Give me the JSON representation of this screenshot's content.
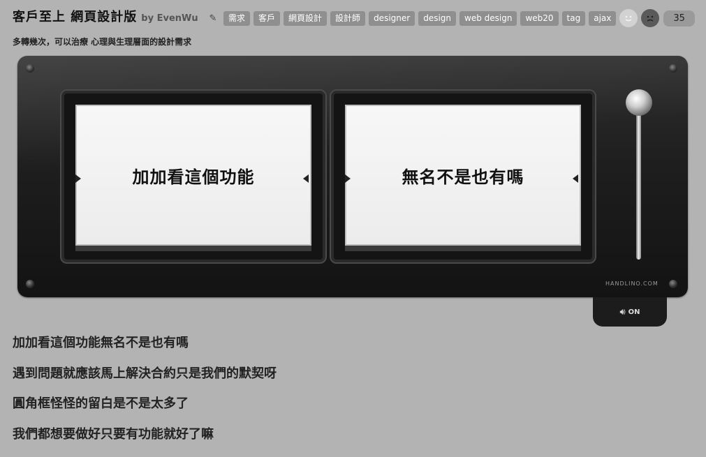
{
  "header": {
    "title": "客戶至上 網頁設計版",
    "byline": "by EvenWu",
    "edit_icon": "pencil-icon",
    "tags": [
      "需求",
      "客戶",
      "網頁設計",
      "設計師",
      "designer",
      "design",
      "web design",
      "web20",
      "tag",
      "ajax"
    ],
    "happy_icon": "smiley-face-icon",
    "sad_icon": "sad-face-icon",
    "vote_count": "35"
  },
  "subtitle": "多轉幾次，可以治療 心理與生理層面的設計需求",
  "slots": {
    "left_text": "加加看這個功能",
    "right_text": "無名不是也有嗎"
  },
  "device": {
    "brand": "HANDLINO.COM",
    "sound_icon": "speaker-icon",
    "sound_label": "ON"
  },
  "results": [
    "加加看這個功能無名不是也有嗎",
    "遇到問題就應該馬上解決合約只是我們的默契呀",
    "圓角框怪怪的留白是不是太多了",
    "我們都想要做好只要有功能就好了嘛"
  ]
}
